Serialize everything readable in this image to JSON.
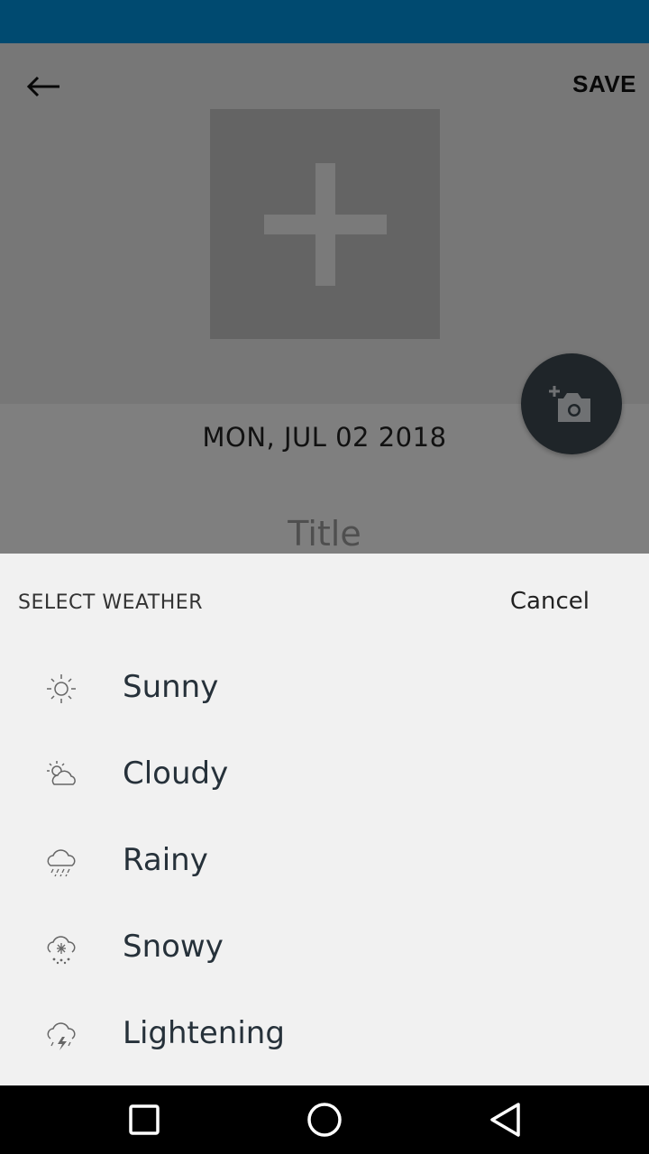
{
  "header": {
    "save_label": "SAVE"
  },
  "entry": {
    "date": "MON, JUL 02 2018",
    "title_placeholder": "Title"
  },
  "sheet": {
    "title": "SELECT WEATHER",
    "cancel_label": "Cancel",
    "items": [
      {
        "label": "Sunny",
        "icon": "sun-icon"
      },
      {
        "label": "Cloudy",
        "icon": "cloudy-icon"
      },
      {
        "label": "Rainy",
        "icon": "rain-icon"
      },
      {
        "label": "Snowy",
        "icon": "snow-icon"
      },
      {
        "label": "Lightening",
        "icon": "lightning-icon"
      }
    ]
  },
  "colors": {
    "status_bar": "#004a70",
    "fab": "#3e4a52",
    "sheet_bg": "#f1f1f1",
    "text_dark": "#26313a"
  }
}
